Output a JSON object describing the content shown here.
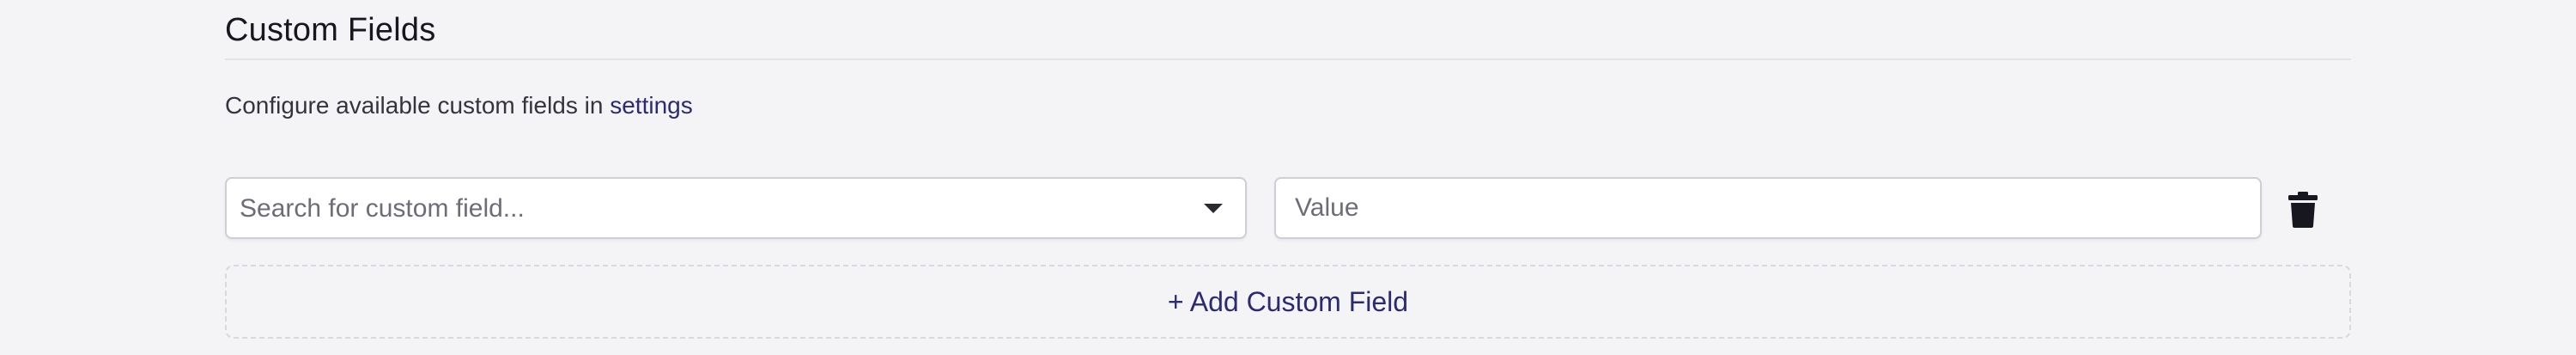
{
  "section": {
    "title": "Custom Fields",
    "description_prefix": "Configure available custom fields in",
    "settings_link": "settings"
  },
  "custom_field_row": {
    "select_placeholder": "Search for custom field...",
    "value_placeholder": "Value",
    "value": "",
    "delete_icon": "trash-icon",
    "dropdown_icon": "caret-down-icon"
  },
  "add_button": {
    "label": "+ Add Custom Field"
  },
  "colors": {
    "background": "#f4f3f6",
    "link": "#2b2a73",
    "border": "#cfcdd6",
    "dashed_border": "#d9d8de"
  }
}
